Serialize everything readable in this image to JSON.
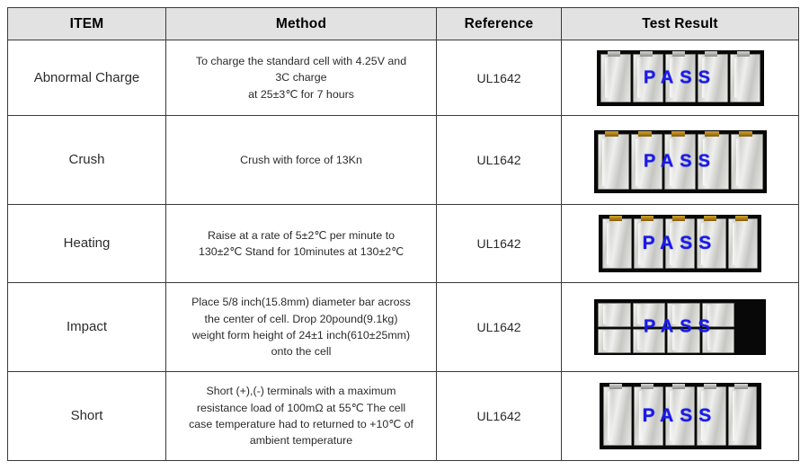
{
  "table": {
    "headers": [
      {
        "label": "ITEM",
        "name": "column-header-item"
      },
      {
        "label": "Method",
        "name": "column-header-method"
      },
      {
        "label": "Reference",
        "name": "column-header-reference"
      },
      {
        "label": "Test Result",
        "name": "column-header-test-result"
      }
    ],
    "rows": [
      {
        "item": "Abnormal\nCharge",
        "item_line1": "Abnormal",
        "item_line2": "Charge",
        "method_lines": [
          "To charge the standard cell  with 4.25V   and",
          "3C charge",
          "at 25±3℃  for 7 hours"
        ],
        "reference": "UL1642",
        "result_label": "PASS",
        "result_image": "abnormal-charge-test-photo",
        "result_cell_count": 5,
        "result_tab_color": "silver",
        "result_layout": "single-row"
      },
      {
        "item": "Crush",
        "item_line1": "Crush",
        "item_line2": "",
        "method_lines": [
          "Crush with force of 13Kn"
        ],
        "reference": "UL1642",
        "result_label": "PASS",
        "result_image": "crush-test-photo",
        "result_cell_count": 5,
        "result_tab_color": "gold",
        "result_layout": "single-row"
      },
      {
        "item": "Heating",
        "item_line1": "Heating",
        "item_line2": "",
        "method_lines": [
          "Raise at a rate of 5±2℃ per minute to",
          "130±2℃ Stand for 10minutes at 130±2℃"
        ],
        "reference": "UL1642",
        "result_label": "PASS",
        "result_image": "heating-test-photo",
        "result_cell_count": 5,
        "result_tab_color": "gold",
        "result_layout": "single-row"
      },
      {
        "item": "Impact",
        "item_line1": "Impact",
        "item_line2": "",
        "method_lines": [
          "Place 5/8 inch(15.8mm)  diameter bar across",
          "the center of cell. Drop 20pound(9.1kg)",
          "weight form height of 24±1 inch(610±25mm)",
          "onto the cell"
        ],
        "reference": "UL1642",
        "result_label": "PASS",
        "result_image": "impact-test-photo",
        "result_cell_count": 10,
        "result_tab_color": "silver",
        "result_layout": "two-row"
      },
      {
        "item": "Short",
        "item_line1": "Short",
        "item_line2": "",
        "method_lines": [
          "Short (+),(-) terminals with a maximum",
          "resistance load of 100mΩ  at 55℃ The cell",
          "case temperature had to returned to +10℃  of",
          "ambient temperature"
        ],
        "reference": "UL1642",
        "result_label": "PASS",
        "result_image": "short-test-photo",
        "result_cell_count": 5,
        "result_tab_color": "silver",
        "result_layout": "single-row"
      }
    ]
  },
  "colors": {
    "header_background": "#e2e2e2",
    "border": "#3a3a3a",
    "pass_text": "#1a1ae6",
    "photo_background": "#080808",
    "text": "#2b2b2b"
  }
}
